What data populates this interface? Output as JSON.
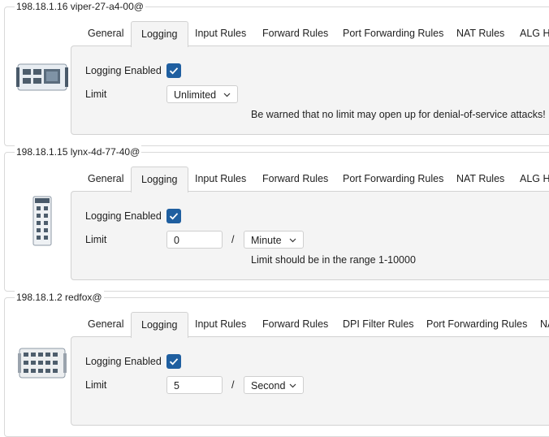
{
  "devices": [
    {
      "title": "198.18.1.16 viper-27-a4-00@",
      "tabs": [
        "General",
        "Logging",
        "Input Rules",
        "Forward Rules",
        "Port Forwarding Rules",
        "NAT Rules",
        "ALG He"
      ],
      "active_tab": "Logging",
      "logging_enabled_label": "Logging Enabled",
      "logging_enabled": true,
      "limit_label": "Limit",
      "limit_select": "Unlimited",
      "note": "Be warned that no limit may open up for denial-of-service attacks!"
    },
    {
      "title": "198.18.1.15 lynx-4d-77-40@",
      "tabs": [
        "General",
        "Logging",
        "Input Rules",
        "Forward Rules",
        "Port Forwarding Rules",
        "NAT Rules",
        "ALG He"
      ],
      "active_tab": "Logging",
      "logging_enabled_label": "Logging Enabled",
      "logging_enabled": true,
      "limit_label": "Limit",
      "limit_value": "0",
      "separator": "/",
      "unit_select": "Minute",
      "note": "Limit should be in the range 1-10000"
    },
    {
      "title": "198.18.1.2 redfox@",
      "tabs": [
        "General",
        "Logging",
        "Input Rules",
        "Forward Rules",
        "DPI Filter Rules",
        "Port Forwarding Rules",
        "NA"
      ],
      "active_tab": "Logging",
      "logging_enabled_label": "Logging Enabled",
      "logging_enabled": true,
      "limit_label": "Limit",
      "limit_value": "5",
      "separator": "/",
      "unit_select": "Second"
    }
  ],
  "colors": {
    "checkbox_fill": "#1f5fa0",
    "panel_bg": "#f4f4f4",
    "border": "#d9d9d9"
  },
  "icons": {
    "device_1": "switch-device-icon",
    "device_2": "din-rail-switch-icon",
    "device_3": "rugged-router-icon",
    "checkbox": "checkmark-icon",
    "dropdown": "chevron-down-icon"
  }
}
